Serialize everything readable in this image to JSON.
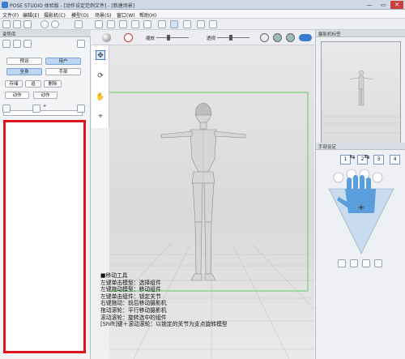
{
  "window": {
    "title": "POSE STUDIO 体验版 - [动作设定范例文件] - [新建场景]",
    "min": "—",
    "max": "▭",
    "close": "✕"
  },
  "menu": [
    "文件(F)",
    "编辑(E)",
    "摄影机(C)",
    "模型(O)",
    "场景(S)",
    "窗口(W)",
    "帮助(H)"
  ],
  "viewbar": {
    "zoom_label": "缩放",
    "perspective_label": "透视"
  },
  "left": {
    "header": "姿势库",
    "tabs": [
      {
        "label": "预设"
      },
      {
        "label": "用户",
        "selected": true
      }
    ],
    "sub_tabs": [
      {
        "label": "全身",
        "selected": true
      },
      {
        "label": "手部"
      }
    ],
    "row3": [
      "存储",
      "追",
      "删除"
    ],
    "row4": [
      "动作",
      "动作"
    ],
    "plus": "+"
  },
  "right": {
    "camera_header": "摄影机标签",
    "camera_numbers": [
      "1",
      "2",
      "3",
      "4"
    ],
    "hand_header": "手部设定"
  },
  "help": [
    "■移动工具",
    "左键单击模型：选择组件",
    "左键拖动模型：移动组件",
    "左键单击组件：锁定关节",
    "右键拖动：前后移动摄影机",
    "拖动滚轮：平行移动摄影机",
    "滚动滚轮：旋转选中的组件",
    "[Shift]键＋滚动滚轮：以锁定的关节为支点旋转模型"
  ],
  "colors": {
    "highlight_frame": "#e0141a",
    "selection_frame": "#3ec83e",
    "accent_blue": "#3b7bd0"
  }
}
